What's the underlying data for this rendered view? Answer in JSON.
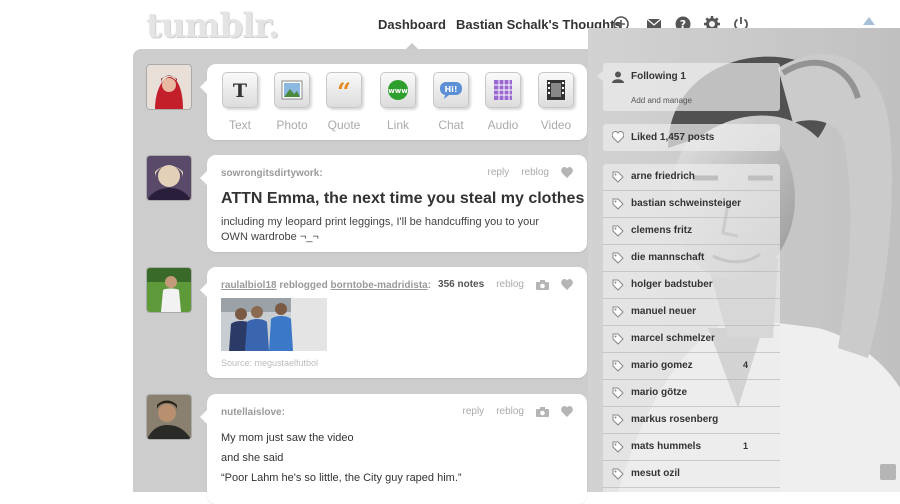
{
  "header": {
    "logo": "tumblr.",
    "nav_dashboard": "Dashboard",
    "nav_blog": "Bastian Schalk's Thoughts",
    "icons": [
      "plus-circle-icon",
      "mail-icon",
      "help-icon",
      "gear-icon",
      "power-icon"
    ]
  },
  "compose": {
    "buttons": [
      {
        "label": "Text",
        "icon": "text-post-icon"
      },
      {
        "label": "Photo",
        "icon": "photo-post-icon"
      },
      {
        "label": "Quote",
        "icon": "quote-post-icon"
      },
      {
        "label": "Link",
        "icon": "link-post-icon"
      },
      {
        "label": "Chat",
        "icon": "chat-post-icon"
      },
      {
        "label": "Audio",
        "icon": "audio-post-icon"
      },
      {
        "label": "Video",
        "icon": "video-post-icon"
      }
    ]
  },
  "posts": [
    {
      "author": "sowrongitsdirtywork:",
      "reply": "reply",
      "reblog": "reblog",
      "title": "ATTN Emma, the next time you steal my clothes",
      "body": "including my leopard print leggings, I'll be handcuffing you to your OWN wardrobe ¬_¬"
    },
    {
      "author": "raulalbiol18",
      "reblogged": "reblogged",
      "source_user": "borntobe-madridista",
      "colon": ":",
      "notes": "356 notes",
      "reblog": "reblog",
      "source": "Source: megustaelfutbol"
    },
    {
      "author": "nutellaislove:",
      "reply": "reply",
      "reblog": "reblog",
      "lines": [
        "My mom just saw the video",
        "and she said",
        "“Poor Lahm he's so little, the City guy raped him.”"
      ]
    }
  ],
  "sidebar": {
    "following": "Following 1",
    "add_and_manage": "Add and manage",
    "liked": "Liked 1,457 posts",
    "tags": [
      {
        "name": "arne friedrich",
        "count": ""
      },
      {
        "name": "bastian schweinsteiger",
        "count": ""
      },
      {
        "name": "clemens fritz",
        "count": ""
      },
      {
        "name": "die mannschaft",
        "count": ""
      },
      {
        "name": "holger badstuber",
        "count": ""
      },
      {
        "name": "manuel neuer",
        "count": ""
      },
      {
        "name": "marcel schmelzer",
        "count": ""
      },
      {
        "name": "mario gomez",
        "count": "4"
      },
      {
        "name": "mario götze",
        "count": ""
      },
      {
        "name": "markus rosenberg",
        "count": ""
      },
      {
        "name": "mats hummels",
        "count": "1"
      },
      {
        "name": "mesut ozil",
        "count": ""
      }
    ]
  },
  "colors": {
    "container": "#cdcdcd",
    "card": "#ffffff",
    "link_green": "#2e9e2e",
    "chat_blue": "#5c8fd6",
    "audio_purple": "#9a6ad0"
  }
}
